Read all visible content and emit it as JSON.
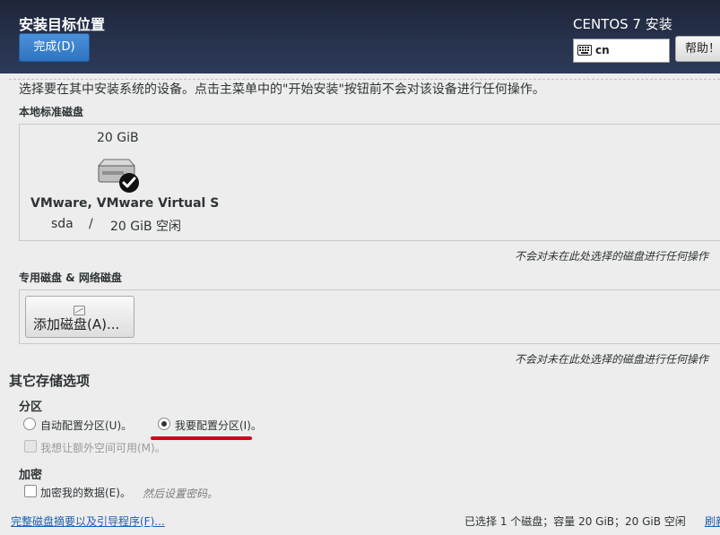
{
  "header": {
    "title": "安装目标位置",
    "done_label": "完成(D)",
    "product": "CENTOS 7 安装",
    "keyboard_layout": "cn",
    "help_label": "帮助！"
  },
  "instruction": "选择要在其中安装系统的设备。点击主菜单中的\"开始安装\"按钮前不会对该设备进行任何操作。",
  "local_disks": {
    "label": "本地标准磁盘",
    "disk": {
      "size": "20 GiB",
      "name": "VMware, VMware Virtual S",
      "device": "sda",
      "separator": "/",
      "free": "20 GiB 空闲",
      "selected": true
    },
    "note": "不会对未在此处选择的磁盘进行任何操作"
  },
  "special_disks": {
    "label": "专用磁盘 & 网络磁盘",
    "add_button": "添加磁盘(A)...",
    "note": "不会对未在此处选择的磁盘进行任何操作"
  },
  "other_options": {
    "heading": "其它存储选项",
    "partitioning": {
      "label": "分区",
      "auto": "自动配置分区(U)。",
      "manual": "我要配置分区(I)。",
      "selected": "manual",
      "extra_space": "我想让额外空间可用(M)。"
    },
    "encryption": {
      "label": "加密",
      "encrypt": "加密我的数据(E)。",
      "hint": "然后设置密码。"
    }
  },
  "footer": {
    "summary_link": "完整磁盘摘要以及引导程序(F)...",
    "status": "已选择 1 个磁盘；容量 20 GiB；20 GiB 空闲",
    "refresh": "刷新"
  },
  "colors": {
    "header_bg": "#27324c",
    "accent_blue": "#2f74c0",
    "annotation_red": "#d0021b"
  }
}
